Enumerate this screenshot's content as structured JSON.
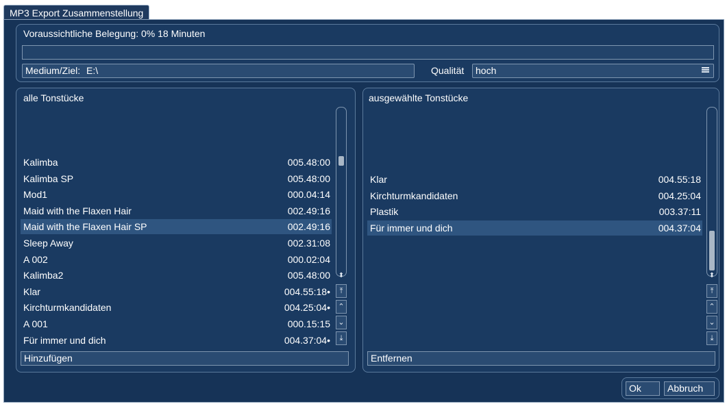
{
  "window": {
    "tab_title": "MP3 Export Zusammenstellung"
  },
  "header": {
    "estimate_label": "Voraussichtliche Belegung: 0% 18 Minuten",
    "usage_percent": 0,
    "medium_label": "Medium/Ziel:",
    "medium_value": "E:\\",
    "quality_label": "Qualität",
    "quality_value": "hoch"
  },
  "left": {
    "title": "alle Tonstücke",
    "rows": [
      {
        "title": "Kalimba",
        "duration": "005.48:00",
        "selected": false
      },
      {
        "title": "Kalimba SP",
        "duration": "005.48:00",
        "selected": false
      },
      {
        "title": "Mod1",
        "duration": "000.04:14",
        "selected": false
      },
      {
        "title": "Maid with the Flaxen Hair",
        "duration": "002.49:16",
        "selected": false
      },
      {
        "title": "Maid with the Flaxen Hair SP",
        "duration": "002.49:16",
        "selected": true
      },
      {
        "title": "Sleep Away",
        "duration": "002.31:08",
        "selected": false
      },
      {
        "title": "A 002",
        "duration": "000.02:04",
        "selected": false
      },
      {
        "title": "Kalimba2",
        "duration": "005.48:00",
        "selected": false
      },
      {
        "title": "Klar",
        "duration": "004.55:18•",
        "selected": false
      },
      {
        "title": "Kirchturmkandidaten",
        "duration": "004.25:04•",
        "selected": false
      },
      {
        "title": "A 001",
        "duration": "000.15:15",
        "selected": false
      },
      {
        "title": "Für immer und dich",
        "duration": "004.37:04•",
        "selected": false
      }
    ],
    "add_button": "Hinzufügen"
  },
  "right": {
    "title": "ausgewählte Tonstücke",
    "rows": [
      {
        "title": "Klar",
        "duration": "004.55:18",
        "selected": false
      },
      {
        "title": "Kirchturmkandidaten",
        "duration": "004.25:04",
        "selected": false
      },
      {
        "title": "Plastik",
        "duration": "003.37:11",
        "selected": false
      },
      {
        "title": "Für immer und dich",
        "duration": "004.37:04",
        "selected": true
      }
    ],
    "remove_button": "Entfernen"
  },
  "footer": {
    "ok_button": "Ok",
    "cancel_button": "Abbruch"
  },
  "icons": {
    "scroll_updown": "updown-arrow-icon",
    "scroll_top": "scroll-top-icon",
    "scroll_up": "scroll-up-icon",
    "scroll_down": "scroll-down-icon",
    "scroll_bottom": "scroll-bottom-icon",
    "menu": "menu-icon"
  },
  "colors": {
    "background": "#163357",
    "panel": "#1a3a61",
    "selection": "#2f5580",
    "border": "#7f96b0"
  }
}
